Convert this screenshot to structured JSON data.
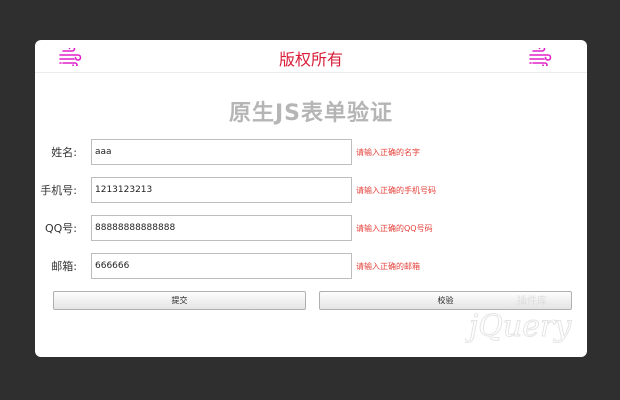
{
  "header": {
    "title": "版权所有",
    "left_icon": "wind-icon",
    "right_icon": "wind-icon",
    "accent_color": "#d81e3a",
    "icon_color": "#e020c8"
  },
  "form": {
    "title": "原生JS表单验证",
    "fields": [
      {
        "label": "姓名:",
        "value": "aaa",
        "hint": "请输入正确的名字"
      },
      {
        "label": "手机号:",
        "value": "1213123213",
        "hint": "请输入正确的手机号码"
      },
      {
        "label": "QQ号:",
        "value": "88888888888888",
        "hint": "请输入正确的QQ号码"
      },
      {
        "label": "邮箱:",
        "value": "666666",
        "hint": "请输入正确的邮箱"
      }
    ],
    "buttons": {
      "submit": "提交",
      "verify": "校验"
    },
    "hint_color": "#e5403a"
  },
  "watermark": {
    "text": "jQuery",
    "subtext": "插件库"
  }
}
